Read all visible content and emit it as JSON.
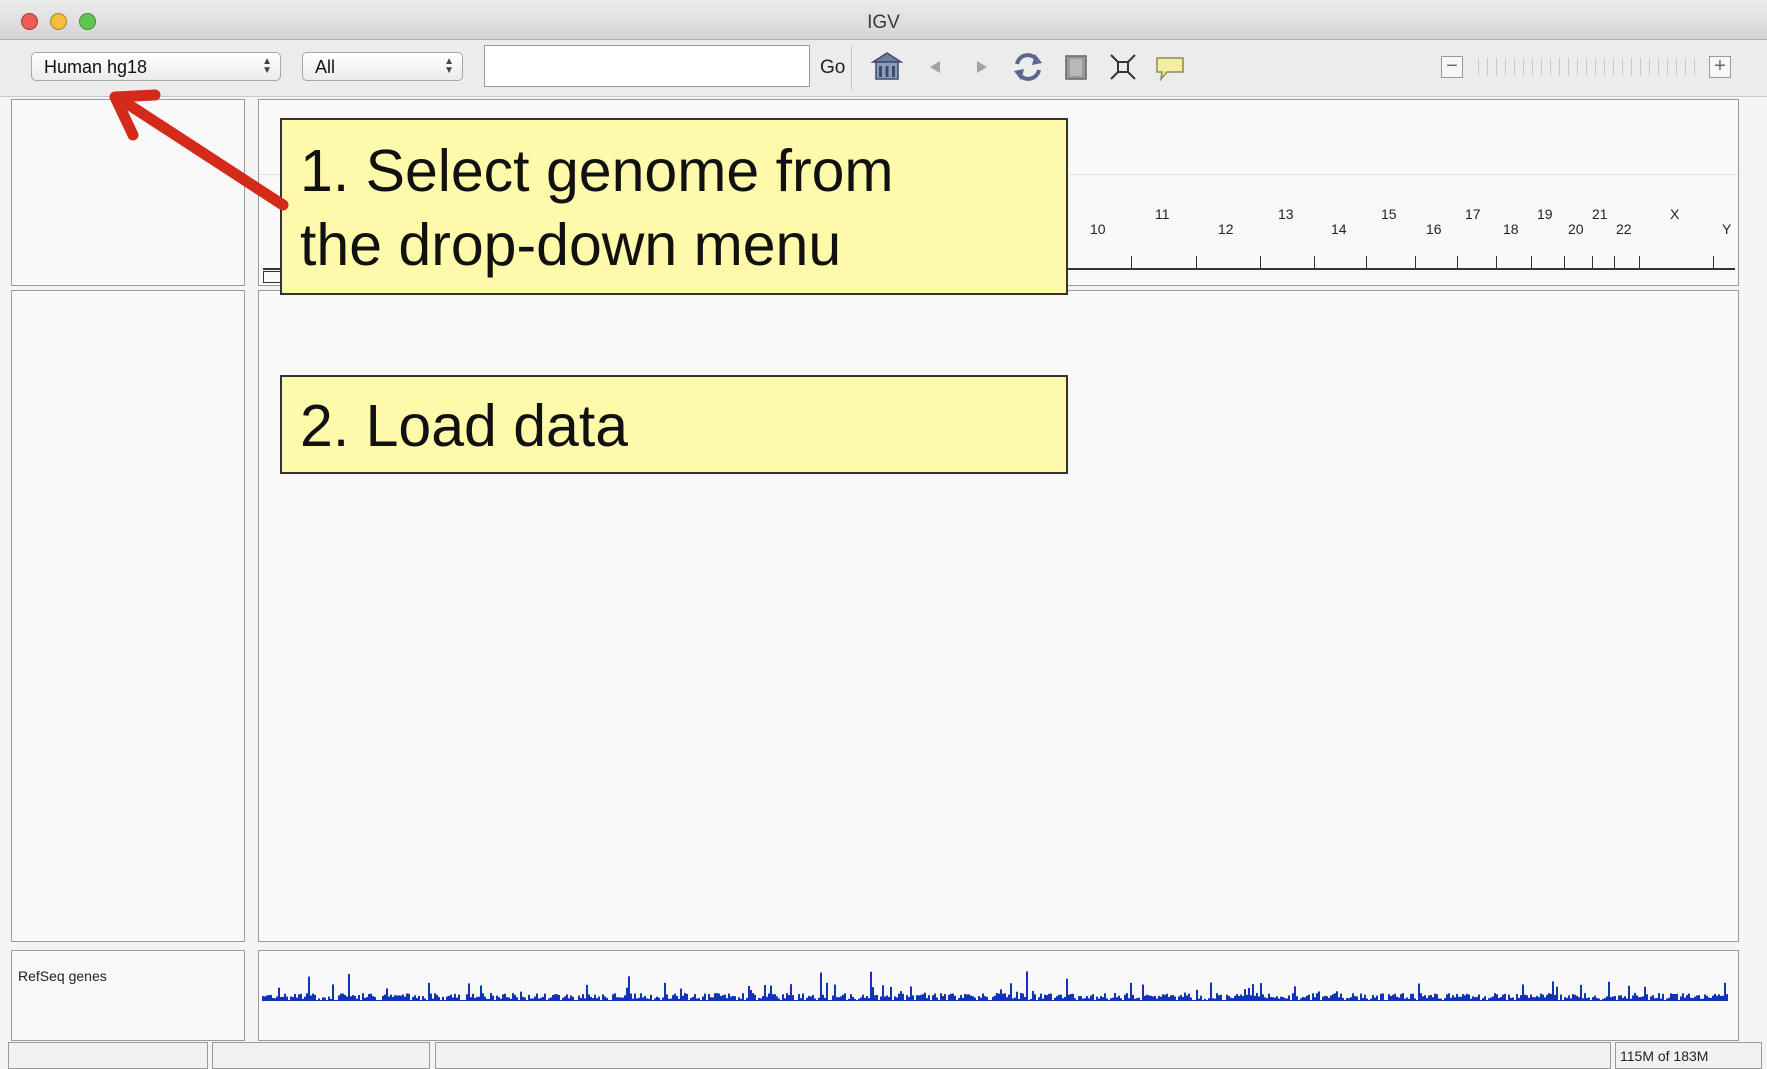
{
  "window": {
    "title": "IGV"
  },
  "toolbar": {
    "genome_selected": "Human hg18",
    "chromosome_selected": "All",
    "locus_value": "",
    "go_label": "Go",
    "icons": [
      "home-icon",
      "back-icon",
      "forward-icon",
      "refresh-icon",
      "region-of-interest-icon",
      "resize-to-window-icon",
      "popup-info-icon"
    ]
  },
  "ruler": {
    "chromosome_labels": [
      "10",
      "11",
      "12",
      "13",
      "14",
      "15",
      "16",
      "17",
      "18",
      "19",
      "20",
      "21",
      "22",
      "X",
      "Y"
    ]
  },
  "annotations": {
    "step1_line1": "1. Select genome from",
    "step1_line2": "the drop-down menu",
    "step2": "2. Load data",
    "arrow_color": "#d42a1a"
  },
  "tracks": {
    "refseq_label": "RefSeq genes",
    "feature_color": "#1133bb"
  },
  "status": {
    "memory": "115M of 183M"
  }
}
